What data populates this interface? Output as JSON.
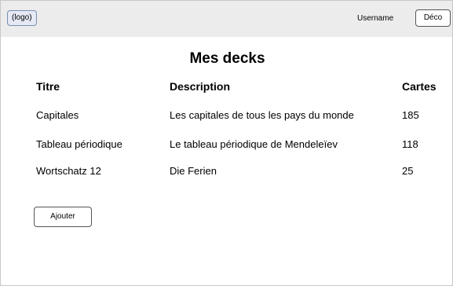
{
  "header": {
    "logo_label": "(logo)",
    "username": "Username",
    "logout_label": "Déco"
  },
  "page": {
    "title": "Mes decks"
  },
  "table": {
    "columns": [
      "Titre",
      "Description",
      "Cartes"
    ],
    "rows": [
      [
        "Capitales",
        "Les capitales de tous les pays du monde",
        "185"
      ],
      [
        "Tableau périodique",
        "Le tableau périodique de Mendeleïev",
        "118"
      ],
      [
        "Wortschatz 12",
        "Die Ferien",
        "25"
      ]
    ]
  },
  "actions": {
    "add_label": "Ajouter"
  }
}
